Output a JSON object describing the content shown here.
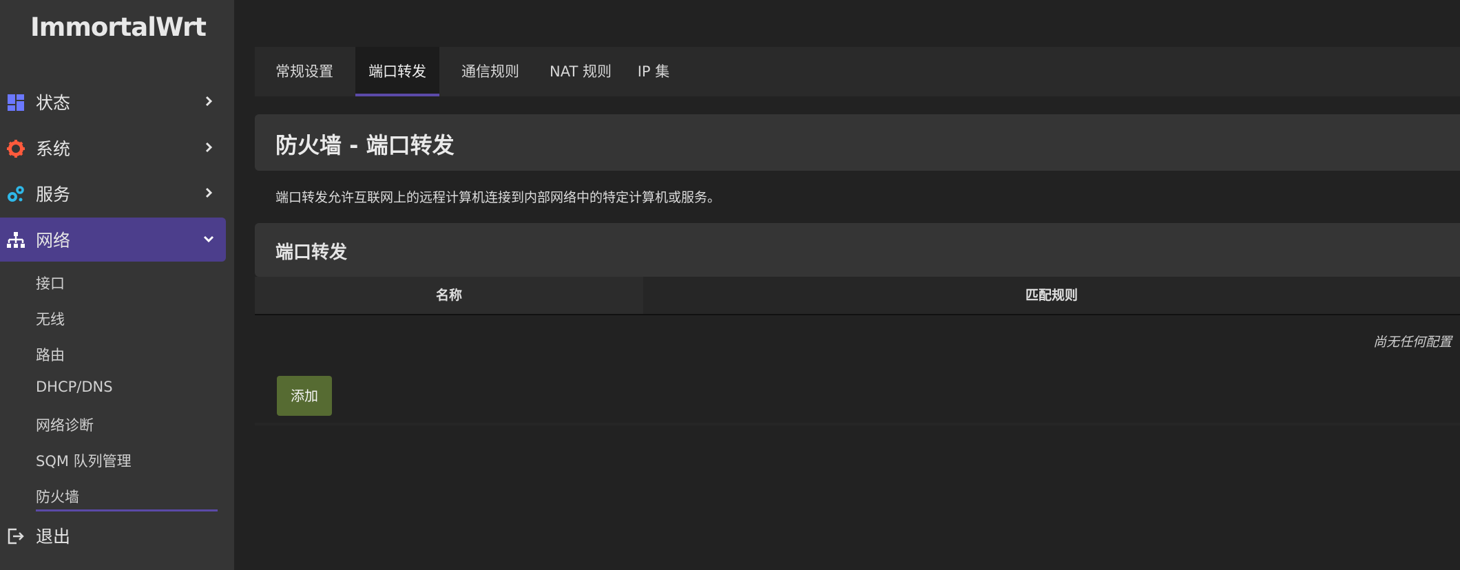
{
  "brand": "ImmortalWrt",
  "sidebar": {
    "items": [
      {
        "label": "状态",
        "icon": "dashboard-icon",
        "color": "#6b78ff"
      },
      {
        "label": "系统",
        "icon": "gear-icon",
        "color": "#ff5a3c"
      },
      {
        "label": "服务",
        "icon": "gears-icon",
        "color": "#2fb8e8"
      },
      {
        "label": "网络",
        "icon": "network-icon",
        "color": "#ffffff"
      }
    ],
    "network_sub": [
      "接口",
      "无线",
      "路由",
      "DHCP/DNS",
      "网络诊断",
      "SQM 队列管理",
      "防火墙"
    ],
    "logout": "退出"
  },
  "tabs": [
    "常规设置",
    "端口转发",
    "通信规则",
    "NAT 规则",
    "IP 集"
  ],
  "active_tab": "端口转发",
  "page": {
    "title": "防火墙 - 端口转发",
    "description": "端口转发允许互联网上的远程计算机连接到内部网络中的特定计算机或服务。"
  },
  "section": {
    "title": "端口转发",
    "columns": [
      "名称",
      "匹配规则"
    ],
    "empty_text": "尚无任何配置",
    "add_label": "添加"
  },
  "colors": {
    "accent": "#4c3e8c",
    "add_button": "#566b32"
  }
}
